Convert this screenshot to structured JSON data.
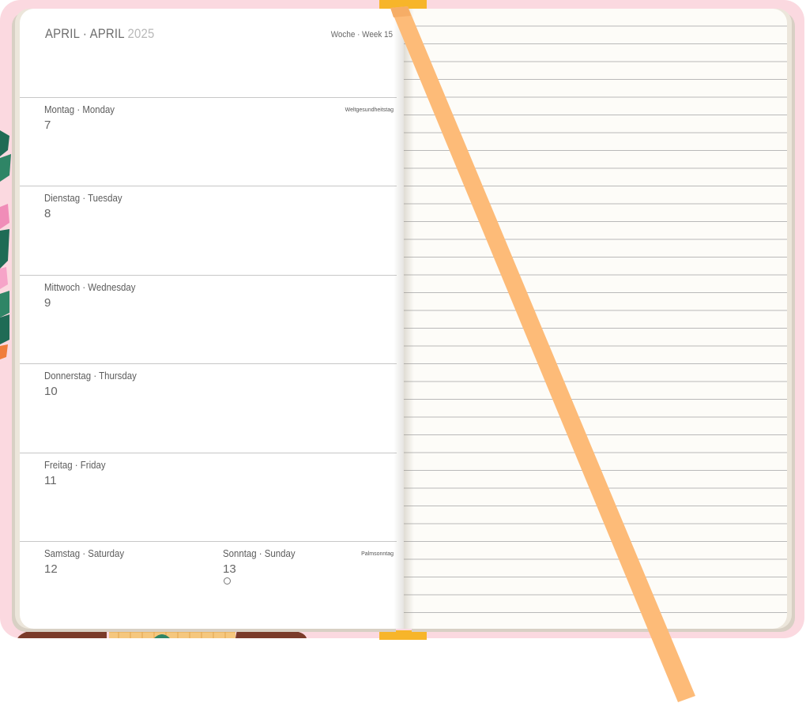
{
  "header": {
    "month_de": "APRIL",
    "separator": "·",
    "month_en": "APRIL",
    "year": "2025",
    "week_de": "Woche",
    "week_en": "Week",
    "week_number": "15"
  },
  "days": [
    {
      "name": "Montag · Monday",
      "date": "7",
      "note": "Weltgesundheitstag"
    },
    {
      "name": "Dienstag · Tuesday",
      "date": "8",
      "note": ""
    },
    {
      "name": "Mittwoch · Wednesday",
      "date": "9",
      "note": ""
    },
    {
      "name": "Donnerstag · Thursday",
      "date": "10",
      "note": ""
    },
    {
      "name": "Freitag · Friday",
      "date": "11",
      "note": ""
    }
  ],
  "weekend": {
    "saturday": {
      "name": "Samstag · Saturday",
      "date": "12"
    },
    "sunday": {
      "name": "Sonntag · Sunday",
      "date": "13",
      "note": "Palmsonntag",
      "moon_icon": "new-moon-icon"
    }
  },
  "notes_page": {
    "line_count": 34
  },
  "colors": {
    "cover": "#fbd9e0",
    "ribbon": "#fdbb78",
    "ribbon_cap": "#f7b52a",
    "ruled_line": "#b9b9b9"
  }
}
